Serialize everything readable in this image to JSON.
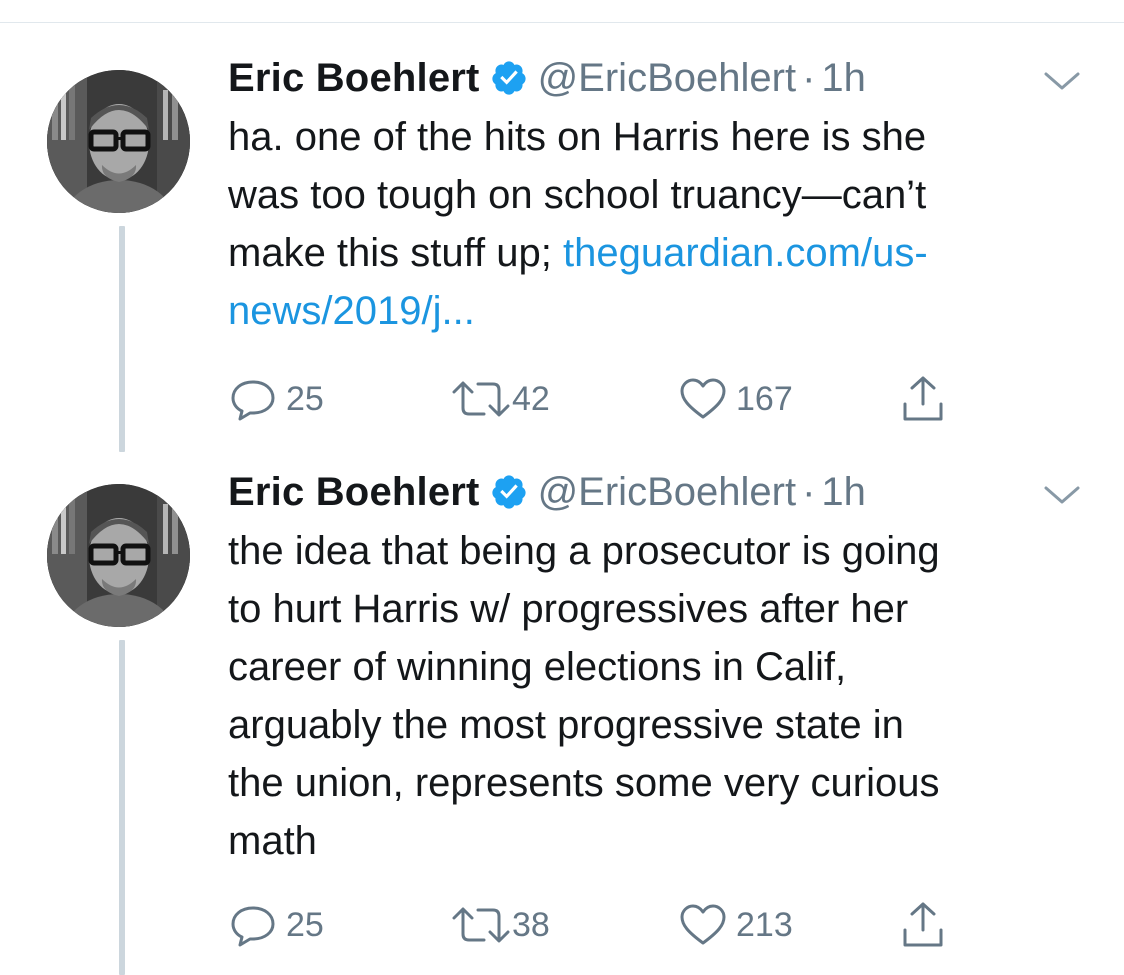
{
  "tweets": [
    {
      "author": "Eric Boehlert",
      "handle": "@EricBoehlert",
      "separator": "·",
      "time": "1h",
      "text_plain": "ha. one of the hits on Harris here is she\nwas too tough on school truancy—can’t\nmake this stuff up; ",
      "link": "theguardian.com/us-\nnews/2019/j...",
      "replies": "25",
      "retweets": "42",
      "likes": "167"
    },
    {
      "author": "Eric Boehlert",
      "handle": "@EricBoehlert",
      "separator": "·",
      "time": "1h",
      "text_plain": "the idea that being a prosecutor is going\nto hurt Harris w/ progressives after her\ncareer of winning elections in Calif,\narguably the most progressive state in\nthe union, represents some very curious\nmath",
      "replies": "25",
      "retweets": "38",
      "likes": "213"
    }
  ],
  "colors": {
    "text": "#14171a",
    "secondary": "#657786",
    "link": "#1b95e0",
    "verified": "#1da1f2",
    "thread_line": "#ccd6dd"
  },
  "icons": [
    "verified-badge-icon",
    "chevron-down-icon",
    "reply-icon",
    "retweet-icon",
    "like-icon",
    "share-icon"
  ]
}
